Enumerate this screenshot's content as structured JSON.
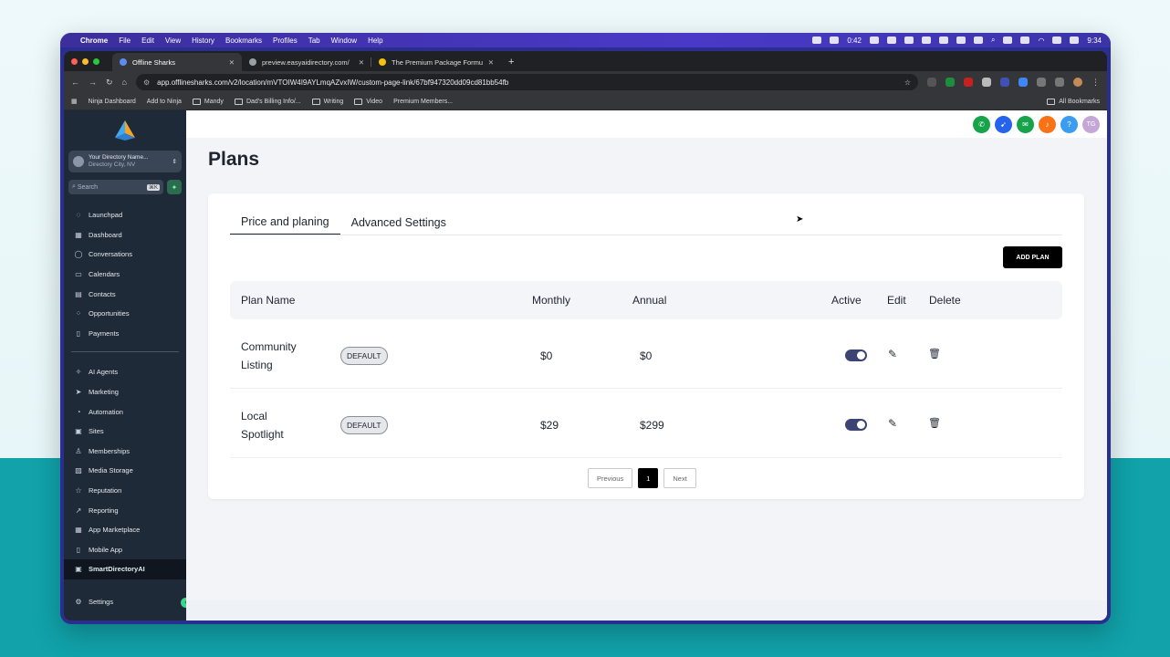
{
  "menubar": {
    "items": [
      "Chrome",
      "File",
      "Edit",
      "View",
      "History",
      "Bookmarks",
      "Profiles",
      "Tab",
      "Window",
      "Help"
    ],
    "battery_timer": "0:42",
    "clock": "9:34"
  },
  "browser": {
    "tabs": [
      {
        "title": "Offline Sharks",
        "active": true
      },
      {
        "title": "preview.easyaidirectory.com/",
        "active": false
      },
      {
        "title": "The Premium Package Formu",
        "active": false
      }
    ],
    "url": "app.offlinesharks.com/v2/location/mVTOIW4I9AYLmqAZvxIW/custom-page-link/67bf947320dd09cd81bb54fb",
    "bookmarks": [
      "Ninja Dashboard",
      "Add to Ninja",
      "Mandy",
      "Dad's Billing Info/...",
      "Writing",
      "Video",
      "Premium Members..."
    ],
    "all_bookmarks": "All Bookmarks"
  },
  "sidebar": {
    "account_name": "Your Directory Name...",
    "account_location": "Directory City, NV",
    "search_placeholder": "Search",
    "search_shortcut": "⌘K",
    "nav_group1": [
      {
        "label": "Launchpad",
        "icon": "rocket-icon"
      },
      {
        "label": "Dashboard",
        "icon": "grid-icon"
      },
      {
        "label": "Conversations",
        "icon": "chat-icon"
      },
      {
        "label": "Calendars",
        "icon": "calendar-icon"
      },
      {
        "label": "Contacts",
        "icon": "contacts-icon"
      },
      {
        "label": "Opportunities",
        "icon": "opportunities-icon"
      },
      {
        "label": "Payments",
        "icon": "payments-icon"
      }
    ],
    "nav_group2": [
      {
        "label": "AI Agents",
        "icon": "sparkle-icon"
      },
      {
        "label": "Marketing",
        "icon": "send-icon"
      },
      {
        "label": "Automation",
        "icon": "automation-icon"
      },
      {
        "label": "Sites",
        "icon": "sites-icon"
      },
      {
        "label": "Memberships",
        "icon": "memberships-icon"
      },
      {
        "label": "Media Storage",
        "icon": "media-icon"
      },
      {
        "label": "Reputation",
        "icon": "star-icon"
      },
      {
        "label": "Reporting",
        "icon": "chart-icon"
      },
      {
        "label": "App Marketplace",
        "icon": "apps-icon"
      },
      {
        "label": "Mobile App",
        "icon": "mobile-icon"
      },
      {
        "label": "SmartDirectoryAI",
        "icon": "directory-icon"
      }
    ],
    "settings_label": "Settings"
  },
  "topbar": {
    "avatar_initials": "TG",
    "help": "?",
    "notification_count": "21"
  },
  "page": {
    "title": "Plans",
    "tabs": [
      "Price and planing",
      "Advanced Settings"
    ],
    "add_plan_label": "ADD PLAN",
    "columns": {
      "plan_name": "Plan Name",
      "monthly": "Monthly",
      "annual": "Annual",
      "active": "Active",
      "edit": "Edit",
      "delete": "Delete"
    },
    "rows": [
      {
        "name_line1": "Community",
        "name_line2": "Listing",
        "badge": "DEFAULT",
        "monthly": "$0",
        "annual": "$0",
        "active": true
      },
      {
        "name_line1": "Local",
        "name_line2": "Spotlight",
        "badge": "DEFAULT",
        "monthly": "$29",
        "annual": "$299",
        "active": true
      }
    ],
    "pagination": {
      "previous": "Previous",
      "current": "1",
      "next": "Next"
    }
  },
  "colors": {
    "sidebar_bg": "#1f2a38",
    "primary_button": "#000000",
    "toggle_on": "#3b4472",
    "background_teal": "#11a2aa",
    "frame": "#2a2f8f"
  }
}
